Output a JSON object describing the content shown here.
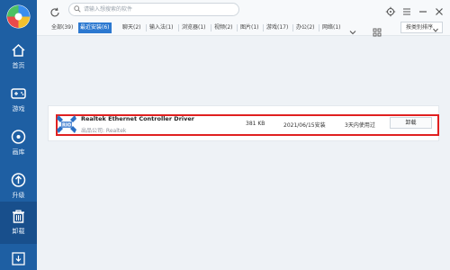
{
  "search": {
    "placeholder": "请输入想搜索的软件"
  },
  "sidebar": {
    "items": [
      {
        "label": "首页",
        "icon": "home-icon"
      },
      {
        "label": "游戏",
        "icon": "gamepad-icon"
      },
      {
        "label": "画库",
        "icon": "disc-icon"
      },
      {
        "label": "升级",
        "icon": "upgrade-icon"
      },
      {
        "label": "卸载",
        "icon": "trash-icon",
        "active": true
      }
    ],
    "bottom_icon": "download-icon"
  },
  "window_controls": [
    "settings-icon",
    "menu-icon",
    "minimize-icon",
    "close-icon"
  ],
  "tabs": [
    {
      "label": "全部(39)"
    },
    {
      "label": "最近安装(6)",
      "active": true
    },
    {
      "label": "聊天(2)"
    },
    {
      "label": "输入法(1)"
    },
    {
      "label": "浏览器(1)"
    },
    {
      "label": "视频(2)"
    },
    {
      "label": "图片(1)"
    },
    {
      "label": "游戏(17)"
    },
    {
      "label": "办公(2)"
    },
    {
      "label": "网络(1)"
    }
  ],
  "sort": {
    "label": "按类别排序"
  },
  "app": {
    "name": "Realtek Ethernet Controller Driver",
    "publisher": "出品公司: Realtek",
    "size": "381 KB",
    "install_date": "2021/06/15安装",
    "last_used": "3天内使用过",
    "uninstall_label": "卸载"
  },
  "colors": {
    "sidebar": "#1e5fa3",
    "accent": "#2b78d0",
    "highlight": "#e02020"
  }
}
